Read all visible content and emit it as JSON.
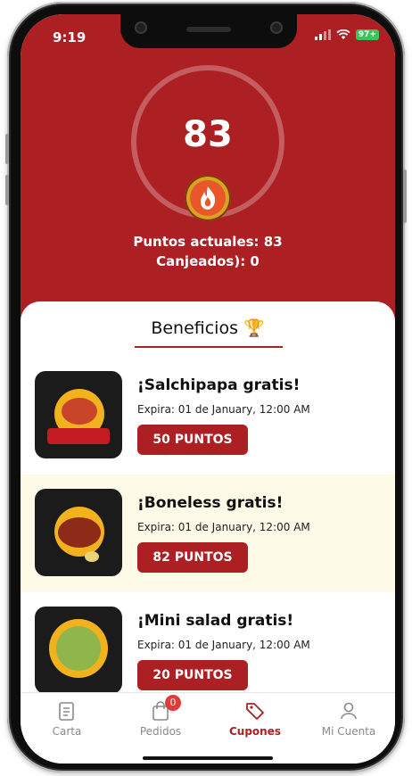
{
  "status": {
    "time": "9:19",
    "battery": "97+"
  },
  "points": {
    "value": "83",
    "current_label": "Puntos actuales: 83",
    "redeemed_label": "Canjeados): 0"
  },
  "benefits": {
    "title": "Beneficios 🏆",
    "items": [
      {
        "title": "¡Salchipapa gratis!",
        "expiry": "Expira: 01 de January, 12:00 AM",
        "points_label": "50 PUNTOS"
      },
      {
        "title": "¡Boneless gratis!",
        "expiry": "Expira: 01 de January, 12:00 AM",
        "points_label": "82 PUNTOS"
      },
      {
        "title": "¡Mini salad gratis!",
        "expiry": "Expira: 01 de January, 12:00 AM",
        "points_label": "20 PUNTOS"
      }
    ]
  },
  "nav": {
    "items": [
      {
        "label": "Carta",
        "icon": "menu-card-icon"
      },
      {
        "label": "Pedidos",
        "icon": "shopping-bag-icon",
        "badge": "0"
      },
      {
        "label": "Cupones",
        "icon": "tag-icon",
        "active": true
      },
      {
        "label": "Mi Cuenta",
        "icon": "user-icon"
      }
    ]
  },
  "colors": {
    "brand_red": "#ac1f23",
    "highlight_row": "#fdfae8",
    "badge_red": "#e03b3b"
  }
}
